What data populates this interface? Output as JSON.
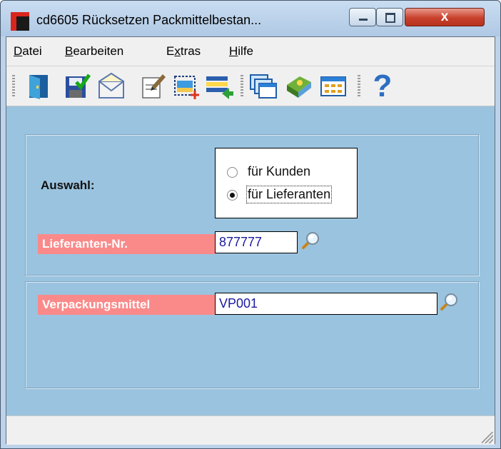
{
  "window": {
    "title": "cd6605 Rücksetzen Packmittelbestan...",
    "close_glyph": "x"
  },
  "menu": [
    {
      "label": "Datei",
      "mnemonic": "D"
    },
    {
      "label": "Bearbeiten",
      "mnemonic": "B"
    },
    {
      "label": "Extras",
      "mnemonic": "x"
    },
    {
      "label": "Hilfe",
      "mnemonic": "H"
    }
  ],
  "toolbar": {
    "icons": [
      "exit-door-icon",
      "save-check-icon",
      "mail-icon",
      "edit-document-icon",
      "new-frame-icon",
      "transfer-list-icon",
      "windows-icon",
      "book-icon",
      "table-grid-icon",
      "help-icon"
    ],
    "help_glyph": "?"
  },
  "form": {
    "auswahl_label": "Auswahl:",
    "radio_kunden": "für Kunden",
    "radio_lieferanten": "für Lieferanten",
    "selected": "lieferanten",
    "lieferant_label": "Lieferanten-Nr.",
    "lieferant_value": "877777",
    "verpackung_label": "Verpackungsmittel",
    "verpackung_value": "VP001"
  },
  "colors": {
    "client_bg": "#9ac3df",
    "label_red": "#fa8a8a",
    "value_text": "#1a1aa0"
  }
}
